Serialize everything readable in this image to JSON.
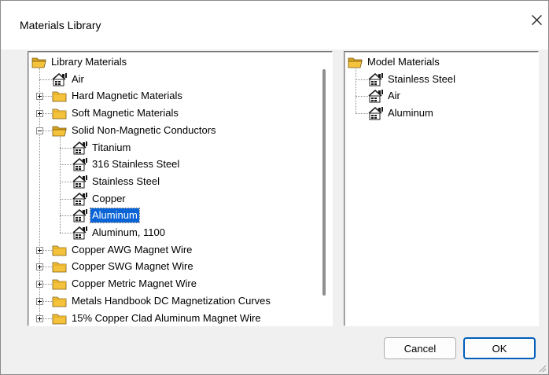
{
  "window": {
    "title": "Materials Library"
  },
  "library": {
    "root_label": "Library Materials",
    "items": [
      {
        "label": "Air",
        "type": "material",
        "level": 1
      },
      {
        "label": "Hard Magnetic Materials",
        "type": "folder",
        "level": 1,
        "expander": "plus"
      },
      {
        "label": "Soft Magnetic Materials",
        "type": "folder",
        "level": 1,
        "expander": "plus"
      },
      {
        "label": "Solid Non-Magnetic Conductors",
        "type": "folder",
        "level": 1,
        "expander": "minus",
        "open": true
      },
      {
        "label": "Titanium",
        "type": "material",
        "level": 2
      },
      {
        "label": "316 Stainless Steel",
        "type": "material",
        "level": 2
      },
      {
        "label": "Stainless Steel",
        "type": "material",
        "level": 2
      },
      {
        "label": "Copper",
        "type": "material",
        "level": 2
      },
      {
        "label": "Aluminum",
        "type": "material",
        "level": 2,
        "selected": true
      },
      {
        "label": "Aluminum, 1100",
        "type": "material",
        "level": 2
      },
      {
        "label": "Copper AWG Magnet Wire",
        "type": "folder",
        "level": 1,
        "expander": "plus"
      },
      {
        "label": "Copper SWG Magnet Wire",
        "type": "folder",
        "level": 1,
        "expander": "plus"
      },
      {
        "label": "Copper Metric Magnet Wire",
        "type": "folder",
        "level": 1,
        "expander": "plus"
      },
      {
        "label": "Metals Handbook DC Magnetization Curves",
        "type": "folder",
        "level": 1,
        "expander": "plus"
      },
      {
        "label": "15% Copper Clad Aluminum Magnet Wire",
        "type": "folder",
        "level": 1,
        "expander": "plus"
      }
    ]
  },
  "model": {
    "root_label": "Model Materials",
    "items": [
      {
        "label": "Stainless Steel",
        "type": "material",
        "level": 1
      },
      {
        "label": "Air",
        "type": "material",
        "level": 1
      },
      {
        "label": "Aluminum",
        "type": "material",
        "level": 1
      }
    ]
  },
  "buttons": {
    "cancel_label": "Cancel",
    "ok_label": "OK"
  },
  "colors": {
    "selection": "#0a64d6",
    "folder": "#f5c33b",
    "ok_border": "#005fb8"
  }
}
